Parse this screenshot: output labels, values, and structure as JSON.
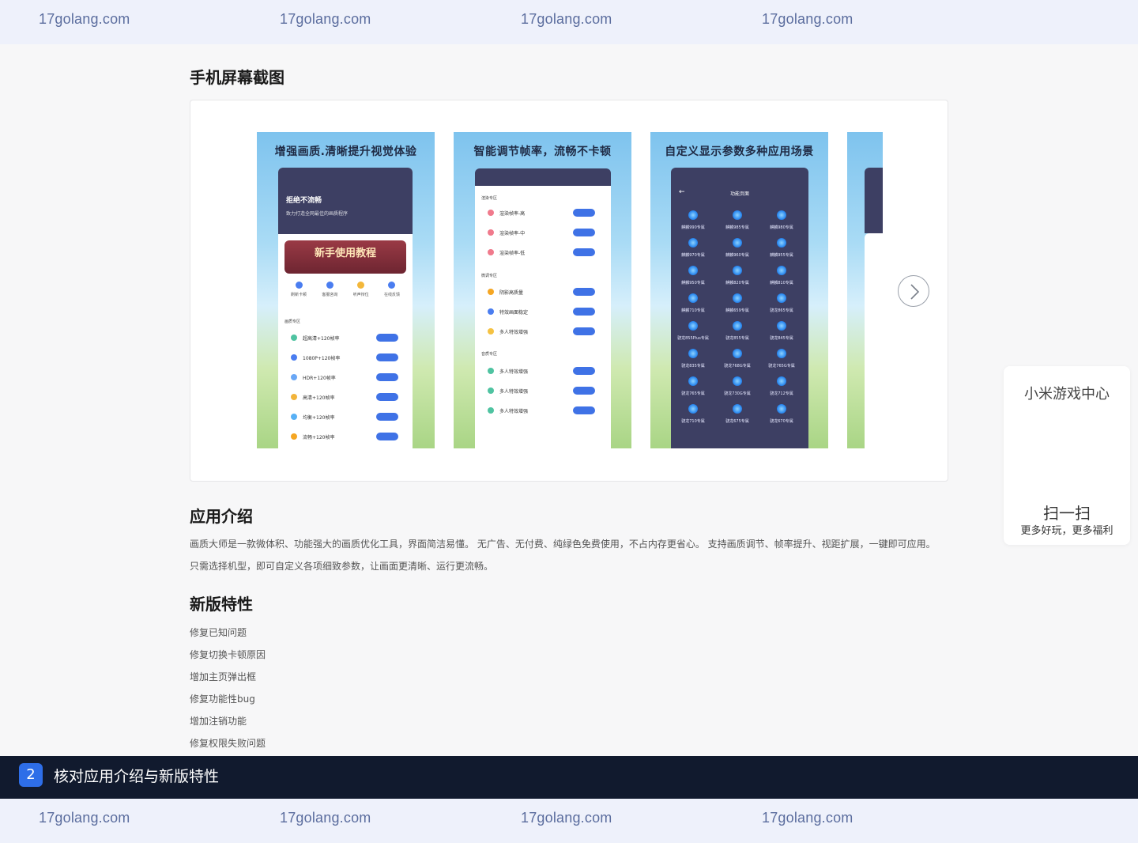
{
  "watermark": {
    "text": "17golang.com"
  },
  "screenshots_section": {
    "title": "手机屏幕截图",
    "shots": [
      {
        "title": "增强画质.清晰提升视觉体验",
        "header": "拒绝不流畅",
        "subheader": "致力打造全网最佳的画质程序",
        "banner": "新手使用教程",
        "icons": [
          "刷新卡顿",
          "客服咨询",
          "听声辩位",
          "在线反馈"
        ],
        "group": "画质专区",
        "options": [
          "超高清+120帧率",
          "1080P+120帧率",
          "HDR+120帧率",
          "高清+120帧率",
          "均衡+120帧率",
          "流畅+120帧率"
        ]
      },
      {
        "title": "智能调节帧率，流畅不卡顿",
        "groups": [
          {
            "name": "渲染专区",
            "options": [
              "渲染帧率-高",
              "渲染帧率-中",
              "渲染帧率-低"
            ]
          },
          {
            "name": "微调专区",
            "options": [
              "阴影高质量",
              "特效画面稳定",
              "多人特效增强"
            ]
          },
          {
            "name": "音质专区",
            "options": [
              "多人特效增强",
              "多人特效增强",
              "多人特效增强"
            ]
          }
        ]
      },
      {
        "title": "自定义显示参数多种应用场景",
        "header": "功能页面",
        "grid": [
          "麒麟990专属",
          "麒麟985专属",
          "麒麟980专属",
          "麒麟970专属",
          "麒麟960专属",
          "麒麟955专属",
          "麒麟950专属",
          "麒麟820专属",
          "麒麟810专属",
          "麒麟710专属",
          "麒麟659专属",
          "骁龙865专属",
          "骁龙855Plus专属",
          "骁龙855专属",
          "骁龙845专属",
          "骁龙835专属",
          "骁龙768G专属",
          "骁龙765G专属",
          "骁龙765专属",
          "骁龙730G专属",
          "骁龙712专属",
          "骁龙710专属",
          "骁龙675专属",
          "骁龙670专属"
        ]
      }
    ]
  },
  "intro": {
    "title": "应用介绍",
    "line1": "画质大师是一款微体积、功能强大的画质优化工具，界面简洁易懂。 无广告、无付费、纯绿色免费使用，不占内存更省心。 支持画质调节、帧率提升、视距扩展，一键即可应用。",
    "line2": "只需选择机型，即可自定义各项细致参数，让画面更清晰、运行更流畅。"
  },
  "features": {
    "title": "新版特性",
    "items": [
      "修复已知问题",
      "修复切换卡顿原因",
      "增加主页弹出框",
      "修复功能性bug",
      "增加注销功能",
      "修复权限失败问题"
    ]
  },
  "side_card": {
    "title": "小米游戏中心",
    "scan": "扫一扫",
    "slogan": "更多好玩，更多福利"
  },
  "step": {
    "number": "2",
    "text": "核对应用介绍与新版特性"
  },
  "colors": {
    "accent": "#2e6ee8",
    "step_bar": "#111a2e",
    "watermark_bar": "#eef1fb"
  }
}
